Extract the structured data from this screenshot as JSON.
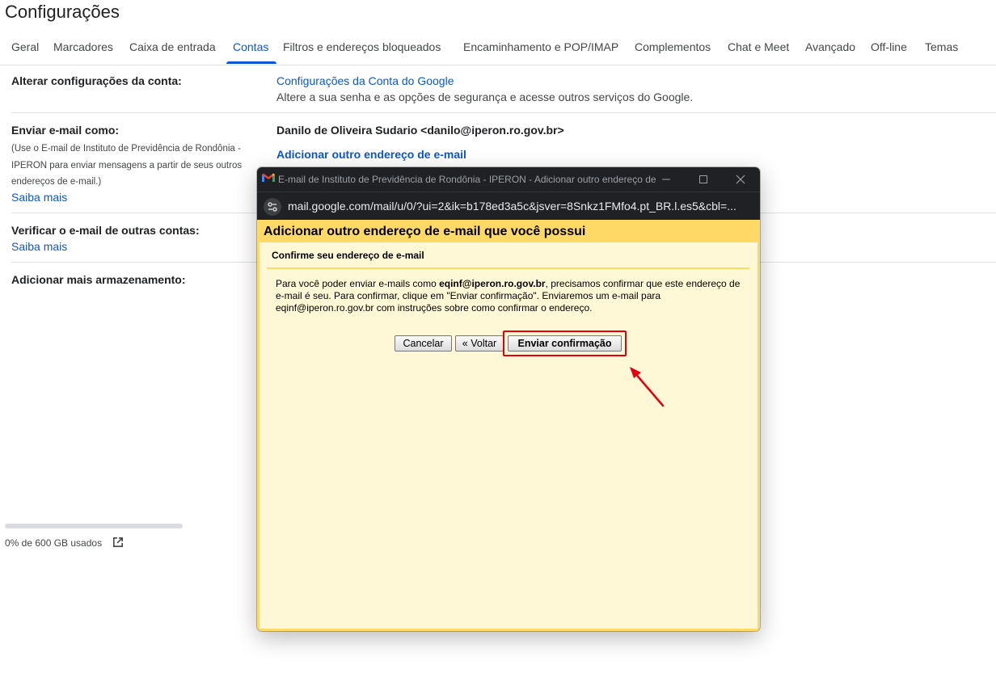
{
  "page_title": "Configurações",
  "tabs": [
    {
      "label": "Geral"
    },
    {
      "label": "Marcadores"
    },
    {
      "label": "Caixa de entrada"
    },
    {
      "label": "Contas"
    },
    {
      "label": "Filtros e endereços bloqueados"
    },
    {
      "label": "Encaminhamento e POP/IMAP"
    },
    {
      "label": "Complementos"
    },
    {
      "label": "Chat e Meet"
    },
    {
      "label": "Avançado"
    },
    {
      "label": "Off-line"
    },
    {
      "label": "Temas"
    }
  ],
  "active_tab": "Contas",
  "sections": {
    "change_account": {
      "label": "Alterar configurações da conta:",
      "link": "Configurações da Conta do Google",
      "description": "Altere a sua senha e as opções de segurança e acesse outros serviços do Google."
    },
    "send_as": {
      "label": "Enviar e-mail como:",
      "note": "(Use o E-mail de Instituto de Previdência de Rondônia - IPERON para enviar mensagens a partir de seus outros endereços de e-mail.)",
      "learn_more": "Saiba mais",
      "identity": "Danilo de Oliveira Sudario <danilo@iperon.ro.gov.br>",
      "add_link": "Adicionar outro endereço de e-mail"
    },
    "check_mail": {
      "label": "Verificar o e-mail de outras contas:",
      "learn_more": "Saiba mais"
    },
    "storage_section": {
      "label": "Adicionar mais armazenamento:"
    }
  },
  "storage": {
    "text": "0% de 600 GB usados",
    "used_fraction": 0.0
  },
  "popup": {
    "window_title": "E-mail de Instituto de Previdência de Rondônia - IPERON - Adicionar outro endereço de e-mail que você possui",
    "url": "mail.google.com/mail/u/0/?ui=2&ik=b178ed3a5c&jsver=8Snkz1FMfo4.pt_BR.l.es5&cbl=...",
    "heading": "Adicionar outro endereço de e-mail que você possui",
    "subheading": "Confirme seu endereço de e-mail",
    "body_prefix": "Para você poder enviar e-mails como ",
    "body_email": "eqinf@iperon.ro.gov.br",
    "body_suffix": ", precisamos confirmar que este endereço de e-mail é seu. Para confirmar, clique em \"Enviar confirmação\". Enviaremos um e-mail para eqinf@iperon.ro.gov.br com instruções sobre como confirmar o endereço.",
    "buttons": {
      "cancel": "Cancelar",
      "back": "« Voltar",
      "send": "Enviar confirmação"
    }
  },
  "colors": {
    "accent": "#0b57d0",
    "dialog_yellow": "#ffd966",
    "dialog_inner": "#fff8d6",
    "annotation_red": "#e3000f"
  }
}
